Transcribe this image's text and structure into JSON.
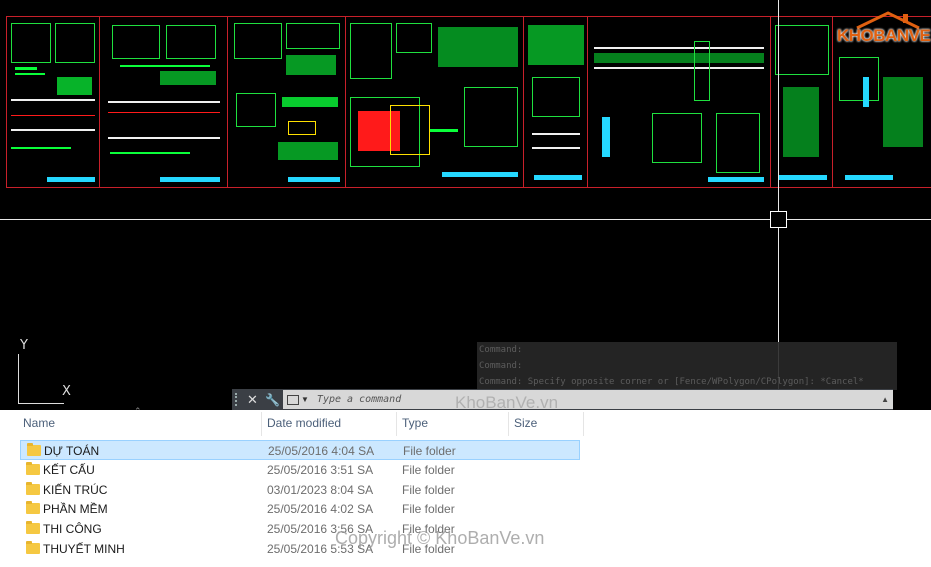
{
  "cad": {
    "command_history": [
      "Command:",
      "Command:",
      "Command: Specify opposite corner or [Fence/WPolygon/CPolygon]: *Cancel*"
    ],
    "command_placeholder": "Type a command",
    "ucs_y": "Y",
    "ucs_x": "X",
    "icons": [
      "grip-icon",
      "close-icon",
      "wrench-icon",
      "command-icon",
      "chevron-up-icon"
    ]
  },
  "logo": {
    "part1": "KHO",
    "part2": "BANVE"
  },
  "watermarks": {
    "top": "KhoBanVe.vn",
    "bottom": "Copyright © KhoBanVe.vn"
  },
  "explorer": {
    "columns": {
      "name": "Name",
      "date": "Date modified",
      "type": "Type",
      "size": "Size"
    },
    "rows": [
      {
        "name": "DỰ TOÁN",
        "date": "25/05/2016 4:04 SA",
        "type": "File folder",
        "selected": true
      },
      {
        "name": "KẾT CẤU",
        "date": "25/05/2016 3:51 SA",
        "type": "File folder"
      },
      {
        "name": "KIẾN TRÚC",
        "date": "03/01/2023 8:04 SA",
        "type": "File folder"
      },
      {
        "name": "PHẦN MỀM",
        "date": "25/05/2016 4:02 SA",
        "type": "File folder"
      },
      {
        "name": "THI CÔNG",
        "date": "25/05/2016 3:56 SA",
        "type": "File folder"
      },
      {
        "name": "THUYẾT MINH",
        "date": "25/05/2016 5:53 SA",
        "type": "File folder"
      }
    ]
  },
  "colors": {
    "cad_bg": "#000000",
    "frame": "#c8202a",
    "linework": "#0aff3a",
    "selection": "#cce8ff"
  }
}
